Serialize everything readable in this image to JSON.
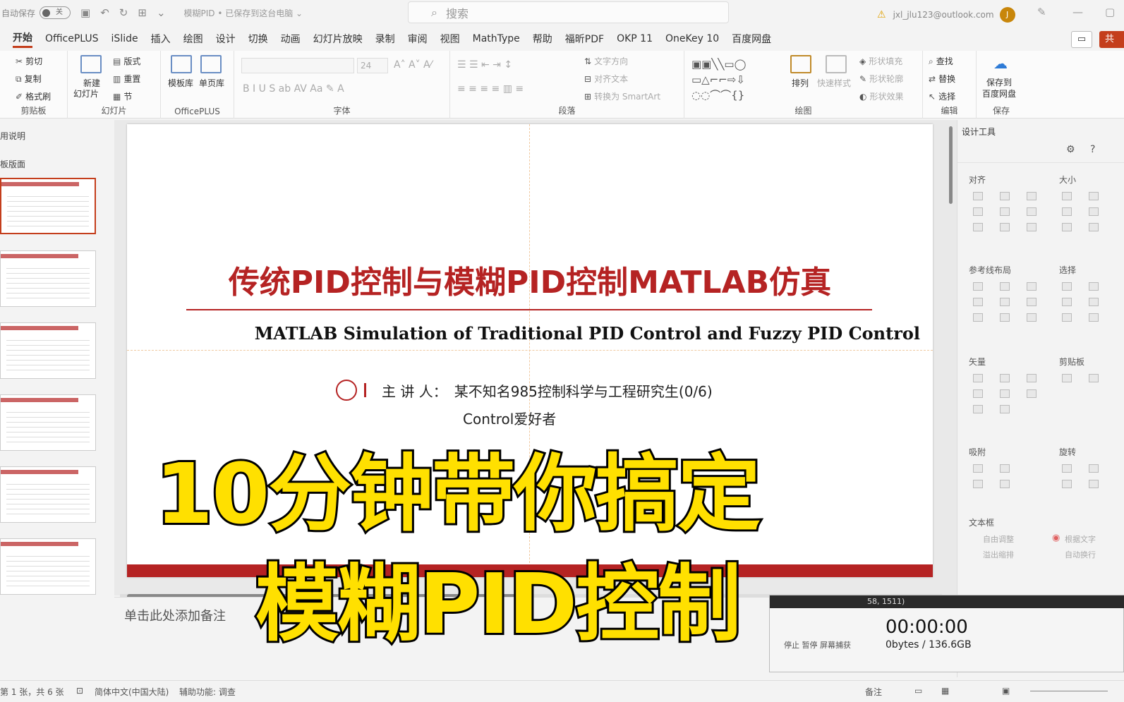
{
  "titlebar": {
    "autosave_label": "自动保存",
    "autosave_state": "关",
    "doc_title": "模糊PID • 已保存到这台电脑 ⌄",
    "search_placeholder": "搜索",
    "account": "jxl_jlu123@outlook.com",
    "avatar_letter": "J"
  },
  "tabs": [
    "开始",
    "OfficePLUS",
    "iSlide",
    "插入",
    "绘图",
    "设计",
    "切换",
    "动画",
    "幻灯片放映",
    "录制",
    "审阅",
    "视图",
    "MathType",
    "帮助",
    "福昕PDF",
    "OKP 11",
    "OneKey 10",
    "百度网盘"
  ],
  "share_label": "共",
  "ribbon": {
    "clipboard": {
      "cut": "剪切",
      "copy": "复制",
      "format_painter": "格式刷",
      "label": "剪贴板"
    },
    "slides": {
      "new_slide": "新建",
      "new_slide2": "幻灯片",
      "layout": "版式",
      "reset": "重置",
      "section": "节",
      "label": "幻灯片"
    },
    "officeplus": {
      "template": "模板库",
      "single": "单页库",
      "label": "OfficePLUS"
    },
    "font": {
      "size": "24",
      "label": "字体"
    },
    "paragraph": {
      "text_direction": "文字方向",
      "align_text": "对齐文本",
      "smartart": "转换为 SmartArt",
      "label": "段落"
    },
    "drawing": {
      "arrange": "排列",
      "quick_styles": "快速样式",
      "fill": "形状填充",
      "outline": "形状轮廓",
      "effects": "形状效果",
      "label": "绘图"
    },
    "editing": {
      "find": "查找",
      "replace": "替换",
      "select": "选择",
      "label": "编辑"
    },
    "save": {
      "save_to": "保存到",
      "baidu": "百度网盘",
      "label": "保存"
    }
  },
  "slide_panel": {
    "section1": "用说明",
    "section2": "板版面",
    "thumb_count": 6
  },
  "slide": {
    "title": "传统PID控制与模糊PID控制MATLAB仿真",
    "subtitle": "MATLAB Simulation of Traditional PID Control and Fuzzy PID Control",
    "speaker_label": "主  讲  人：",
    "speaker_name": "某不知名985控制科学与工程研究生(0/6)",
    "line2": "Control爱好者"
  },
  "notes_placeholder": "单击此处添加备注",
  "design_panel": {
    "title": "设计工具",
    "align": "对齐",
    "size": "大小",
    "guides": "参考线布局",
    "select": "选择",
    "vector": "矢量",
    "clipboard": "剪贴板",
    "snap": "吸附",
    "rotate": "旋转",
    "textbox": "文本框",
    "auto_resize": "自由调整",
    "overflow": "溢出缩排",
    "fit_text": "根据文字",
    "auto_wrap": "自动换行"
  },
  "overlay": {
    "line1": "10分钟带你搞定",
    "line2": "模糊PID控制"
  },
  "recorder": {
    "header": "58, 1511)",
    "time": "00:00:00",
    "size": "0bytes / 136.6GB",
    "labels": "停止   暂停   屏幕捕获"
  },
  "statusbar": {
    "slide_info": "第 1 张，共 6 张",
    "language": "简体中文(中国大陆)",
    "accessibility": "辅助功能: 调查",
    "notes": "备注"
  }
}
